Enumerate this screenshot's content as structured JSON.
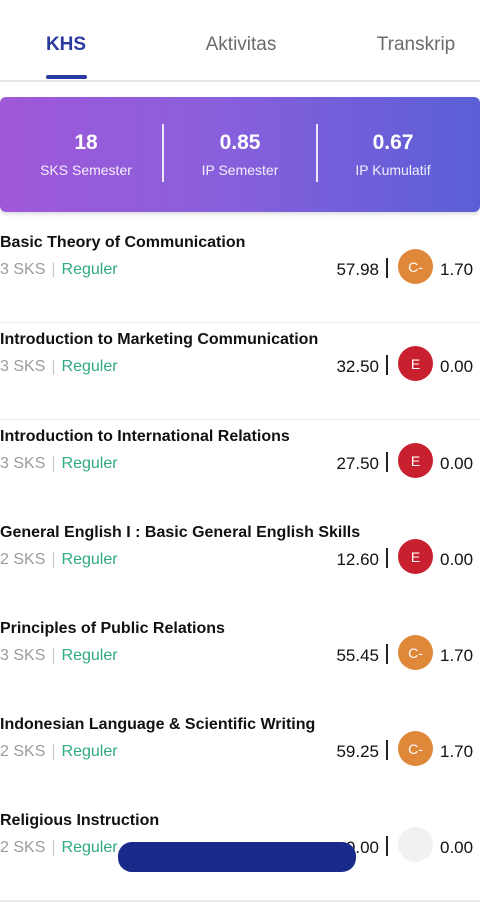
{
  "tabs": [
    {
      "label": "KHS",
      "active": true
    },
    {
      "label": "Aktivitas",
      "active": false
    },
    {
      "label": "Transkrip",
      "active": false
    }
  ],
  "summary": {
    "sks_value": "18",
    "sks_label": "SKS Semester",
    "ips_value": "0.85",
    "ips_label": "IP Semester",
    "ipk_value": "0.67",
    "ipk_label": "IP Kumulatif"
  },
  "colors": {
    "grade_c_minus": "#e0883a",
    "grade_e": "#c8202f",
    "accent": "#2a3aa0",
    "reguler": "#2fa885"
  },
  "courses": [
    {
      "name": "Basic Theory of Communication",
      "sks": "3 SKS",
      "type": "Reguler",
      "score": "57.98",
      "grade": "C-",
      "gpa": "1.70"
    },
    {
      "name": "Introduction to Marketing Communication",
      "sks": "3 SKS",
      "type": "Reguler",
      "score": "32.50",
      "grade": "E",
      "gpa": "0.00"
    },
    {
      "name": "Introduction to International Relations",
      "sks": "3 SKS",
      "type": "Reguler",
      "score": "27.50",
      "grade": "E",
      "gpa": "0.00"
    },
    {
      "name": "General English I : Basic General English Skills",
      "sks": "2 SKS",
      "type": "Reguler",
      "score": "12.60",
      "grade": "E",
      "gpa": "0.00"
    },
    {
      "name": "Principles of Public Relations",
      "sks": "3 SKS",
      "type": "Reguler",
      "score": "55.45",
      "grade": "C-",
      "gpa": "1.70"
    },
    {
      "name": "Indonesian Language & Scientific Writing",
      "sks": "2 SKS",
      "type": "Reguler",
      "score": "59.25",
      "grade": "C-",
      "gpa": "1.70"
    },
    {
      "name": "Religious Instruction",
      "sks": "2 SKS",
      "type": "Reguler",
      "score": "0.00",
      "grade": "",
      "gpa": "0.00"
    }
  ]
}
